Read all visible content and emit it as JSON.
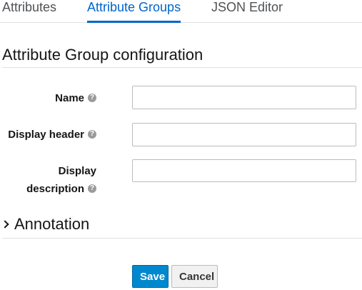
{
  "tabs": [
    {
      "label": "Attributes",
      "active": false
    },
    {
      "label": "Attribute Groups",
      "active": true
    },
    {
      "label": "JSON Editor",
      "active": false
    }
  ],
  "section_title": "Attribute Group configuration",
  "fields": {
    "name": {
      "label": "Name",
      "value": ""
    },
    "display_header": {
      "label": "Display header",
      "value": ""
    },
    "display_description": {
      "label_line1": "Display",
      "label_line2": "description",
      "value": ""
    }
  },
  "annotation": {
    "label": "Annotation",
    "expanded": false
  },
  "buttons": {
    "save": "Save",
    "cancel": "Cancel"
  },
  "colors": {
    "accent": "#0066cc",
    "primary_button": "#0088ce"
  }
}
